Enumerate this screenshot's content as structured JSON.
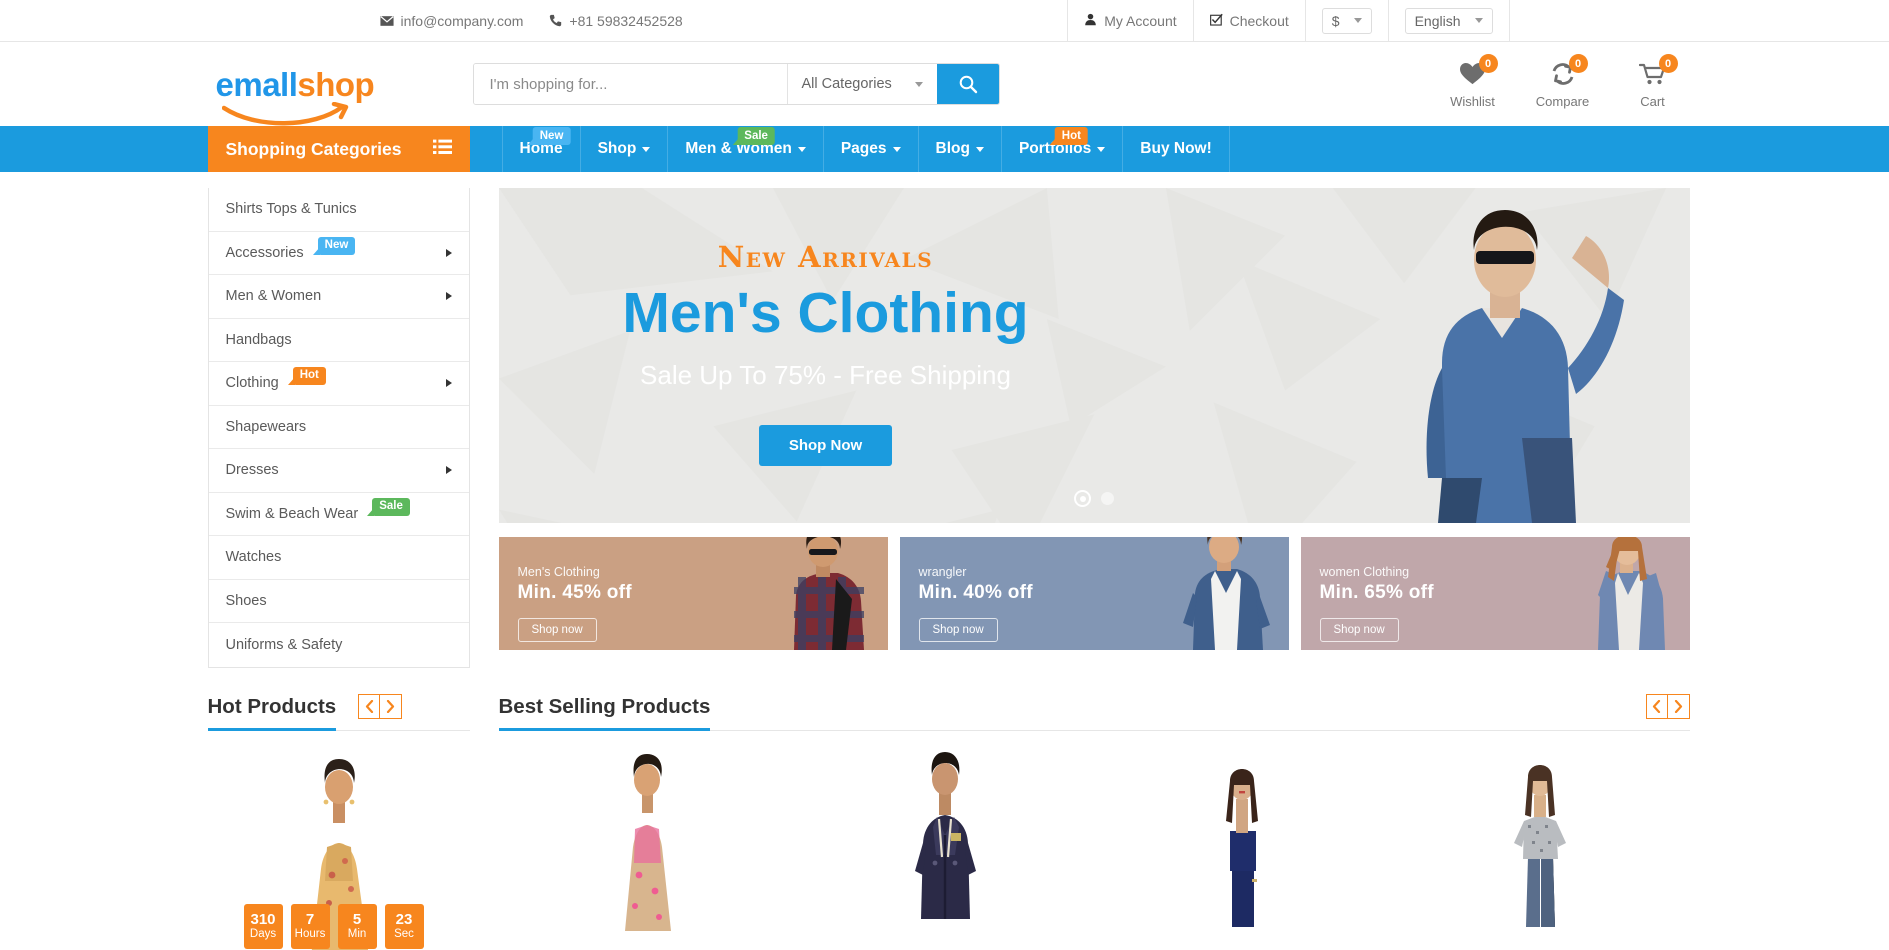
{
  "topbar": {
    "email": "info@company.com",
    "phone": "+81 59832452528",
    "account": "My Account",
    "checkout": "Checkout",
    "currency": "$",
    "language": "English",
    "icons": {
      "mail": "envelope-icon",
      "phone": "phone-icon",
      "user": "user-icon",
      "check": "checkbox-icon"
    }
  },
  "brand": {
    "part1": "emall",
    "part2": "shop"
  },
  "search": {
    "placeholder": "I'm shopping for...",
    "value": "",
    "category": "All Categories",
    "button_icon": "search-icon"
  },
  "header_icons": [
    {
      "name": "wishlist",
      "label": "Wishlist",
      "count": "0",
      "icon": "heart-icon"
    },
    {
      "name": "compare",
      "label": "Compare",
      "count": "0",
      "icon": "refresh-icon"
    },
    {
      "name": "cart",
      "label": "Cart",
      "count": "0",
      "icon": "cart-icon"
    }
  ],
  "categories_header": {
    "title": "Shopping Categories",
    "icon": "list-icon"
  },
  "nav": [
    {
      "label": "Home",
      "caret": false,
      "badge": "New",
      "badge_type": "new"
    },
    {
      "label": "Shop",
      "caret": true,
      "badge": null,
      "badge_type": null
    },
    {
      "label": "Men & Women",
      "caret": true,
      "badge": "Sale",
      "badge_type": "sale"
    },
    {
      "label": "Pages",
      "caret": true,
      "badge": null,
      "badge_type": null
    },
    {
      "label": "Blog",
      "caret": true,
      "badge": null,
      "badge_type": null
    },
    {
      "label": "Portfolios",
      "caret": true,
      "badge": "Hot",
      "badge_type": "hot"
    },
    {
      "label": "Buy Now!",
      "caret": false,
      "badge": null,
      "badge_type": null
    }
  ],
  "sidebar": [
    {
      "label": "Shirts Tops & Tunics",
      "arrow": false,
      "badge": null,
      "badge_type": null
    },
    {
      "label": "Accessories",
      "arrow": true,
      "badge": "New",
      "badge_type": "new"
    },
    {
      "label": "Men & Women",
      "arrow": true,
      "badge": null,
      "badge_type": null
    },
    {
      "label": "Handbags",
      "arrow": false,
      "badge": null,
      "badge_type": null
    },
    {
      "label": "Clothing",
      "arrow": true,
      "badge": "Hot",
      "badge_type": "hot"
    },
    {
      "label": "Shapewears",
      "arrow": false,
      "badge": null,
      "badge_type": null
    },
    {
      "label": "Dresses",
      "arrow": true,
      "badge": null,
      "badge_type": null
    },
    {
      "label": "Swim & Beach Wear",
      "arrow": false,
      "badge": "Sale",
      "badge_type": "sale"
    },
    {
      "label": "Watches",
      "arrow": false,
      "badge": null,
      "badge_type": null
    },
    {
      "label": "Shoes",
      "arrow": false,
      "badge": null,
      "badge_type": null
    },
    {
      "label": "Uniforms & Safety",
      "arrow": false,
      "badge": null,
      "badge_type": null
    }
  ],
  "hero": {
    "kicker": "New Arrivals",
    "title": "Men's Clothing",
    "subtitle": "Sale Up To 75% - Free Shipping",
    "cta": "Shop Now",
    "slides": 2,
    "active_slide": 1
  },
  "promos": [
    {
      "sub": "Men's Clothing",
      "head": "Min. 45% off",
      "cta": "Shop now"
    },
    {
      "sub": "wrangler",
      "head": "Min. 40% off",
      "cta": "Shop now"
    },
    {
      "sub": "women Clothing",
      "head": "Min. 65% off",
      "cta": "Shop now"
    }
  ],
  "sections": {
    "hot_products": "Hot Products",
    "best_selling": "Best Selling Products",
    "prev_icon": "chevron-left-icon",
    "next_icon": "chevron-right-icon"
  },
  "countdown": [
    {
      "value": "310",
      "unit": "Days"
    },
    {
      "value": "7",
      "unit": "Hours"
    },
    {
      "value": "5",
      "unit": "Min"
    },
    {
      "value": "23",
      "unit": "Sec"
    }
  ],
  "colors": {
    "brand_blue": "#1b9bde",
    "brand_orange": "#f7861e",
    "badge_new": "#49b5f2",
    "badge_sale": "#5cb85c",
    "badge_hot": "#f7861e"
  }
}
